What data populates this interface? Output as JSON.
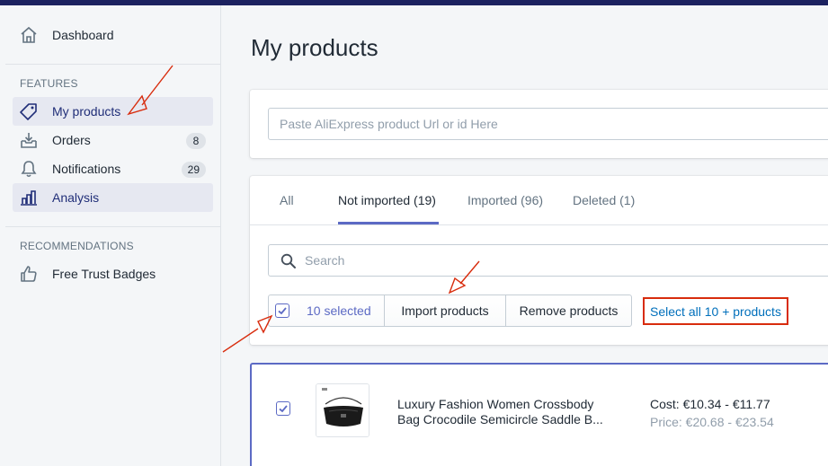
{
  "sidebar": {
    "dashboard_label": "Dashboard",
    "features_title": "FEATURES",
    "items": [
      {
        "label": "My products",
        "icon": "tag-icon",
        "active": true
      },
      {
        "label": "Orders",
        "icon": "inbox-download-icon",
        "badge": "8"
      },
      {
        "label": "Notifications",
        "icon": "bell-icon",
        "badge": "29"
      },
      {
        "label": "Analysis",
        "icon": "bar-chart-icon",
        "active": true
      }
    ],
    "recommendations_title": "RECOMMENDATIONS",
    "recommendations": [
      {
        "label": "Free Trust Badges",
        "icon": "thumbs-up-icon"
      }
    ]
  },
  "main": {
    "title": "My products",
    "url_input": {
      "placeholder": "Paste AliExpress product Url or id Here",
      "value": ""
    },
    "tabs": [
      {
        "label": "All"
      },
      {
        "label": "Not imported (19)",
        "active": true
      },
      {
        "label": "Imported (96)"
      },
      {
        "label": "Deleted (1)"
      }
    ],
    "search": {
      "placeholder": "Search"
    },
    "bulk": {
      "selected_label": "10 selected",
      "import_label": "Import products",
      "remove_label": "Remove products",
      "select_all_label": "Select all 10 + products"
    },
    "products": [
      {
        "title": "Luxury Fashion Women Crossbody Bag Crocodile Semicircle Saddle B...",
        "cost": "Cost: €10.34 - €11.77",
        "price": "Price: €20.68 - €23.54",
        "checked": true
      }
    ]
  },
  "colors": {
    "accent": "#5c6ac4",
    "nav_active_text": "#202e78",
    "link": "#006fbb",
    "annotation_red": "#d82c0d",
    "topbar": "#1c2260"
  }
}
